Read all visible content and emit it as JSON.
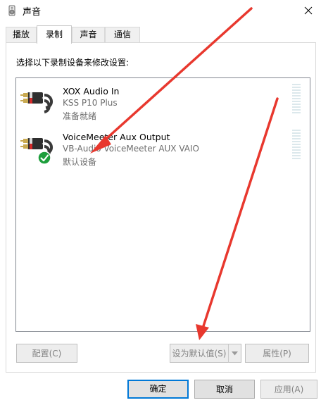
{
  "window": {
    "title": "声音",
    "close_icon": "close-icon"
  },
  "tabs": [
    {
      "label": "播放",
      "active": false
    },
    {
      "label": "录制",
      "active": true
    },
    {
      "label": "声音",
      "active": false
    },
    {
      "label": "通信",
      "active": false
    }
  ],
  "instruction": "选择以下录制设备来修改设置:",
  "devices": [
    {
      "name": "XOX Audio In",
      "subtitle": "KSS P10 Plus",
      "status": "准备就绪",
      "is_default": false,
      "icon": "rca-cable-icon"
    },
    {
      "name": "VoiceMeeter Aux Output",
      "subtitle": "VB-Audio VoiceMeeter AUX VAIO",
      "status": "默认设备",
      "is_default": true,
      "icon": "rca-cable-icon"
    }
  ],
  "panel_buttons": {
    "configure": "配置(C)",
    "set_default": "设为默认值(S)",
    "properties": "属性(P)"
  },
  "dialog_buttons": {
    "ok": "确定",
    "cancel": "取消",
    "apply": "应用(A)"
  },
  "colors": {
    "accent": "#0078d7",
    "annotation_arrow": "#e8382e",
    "default_check": "#1d9e3c"
  }
}
